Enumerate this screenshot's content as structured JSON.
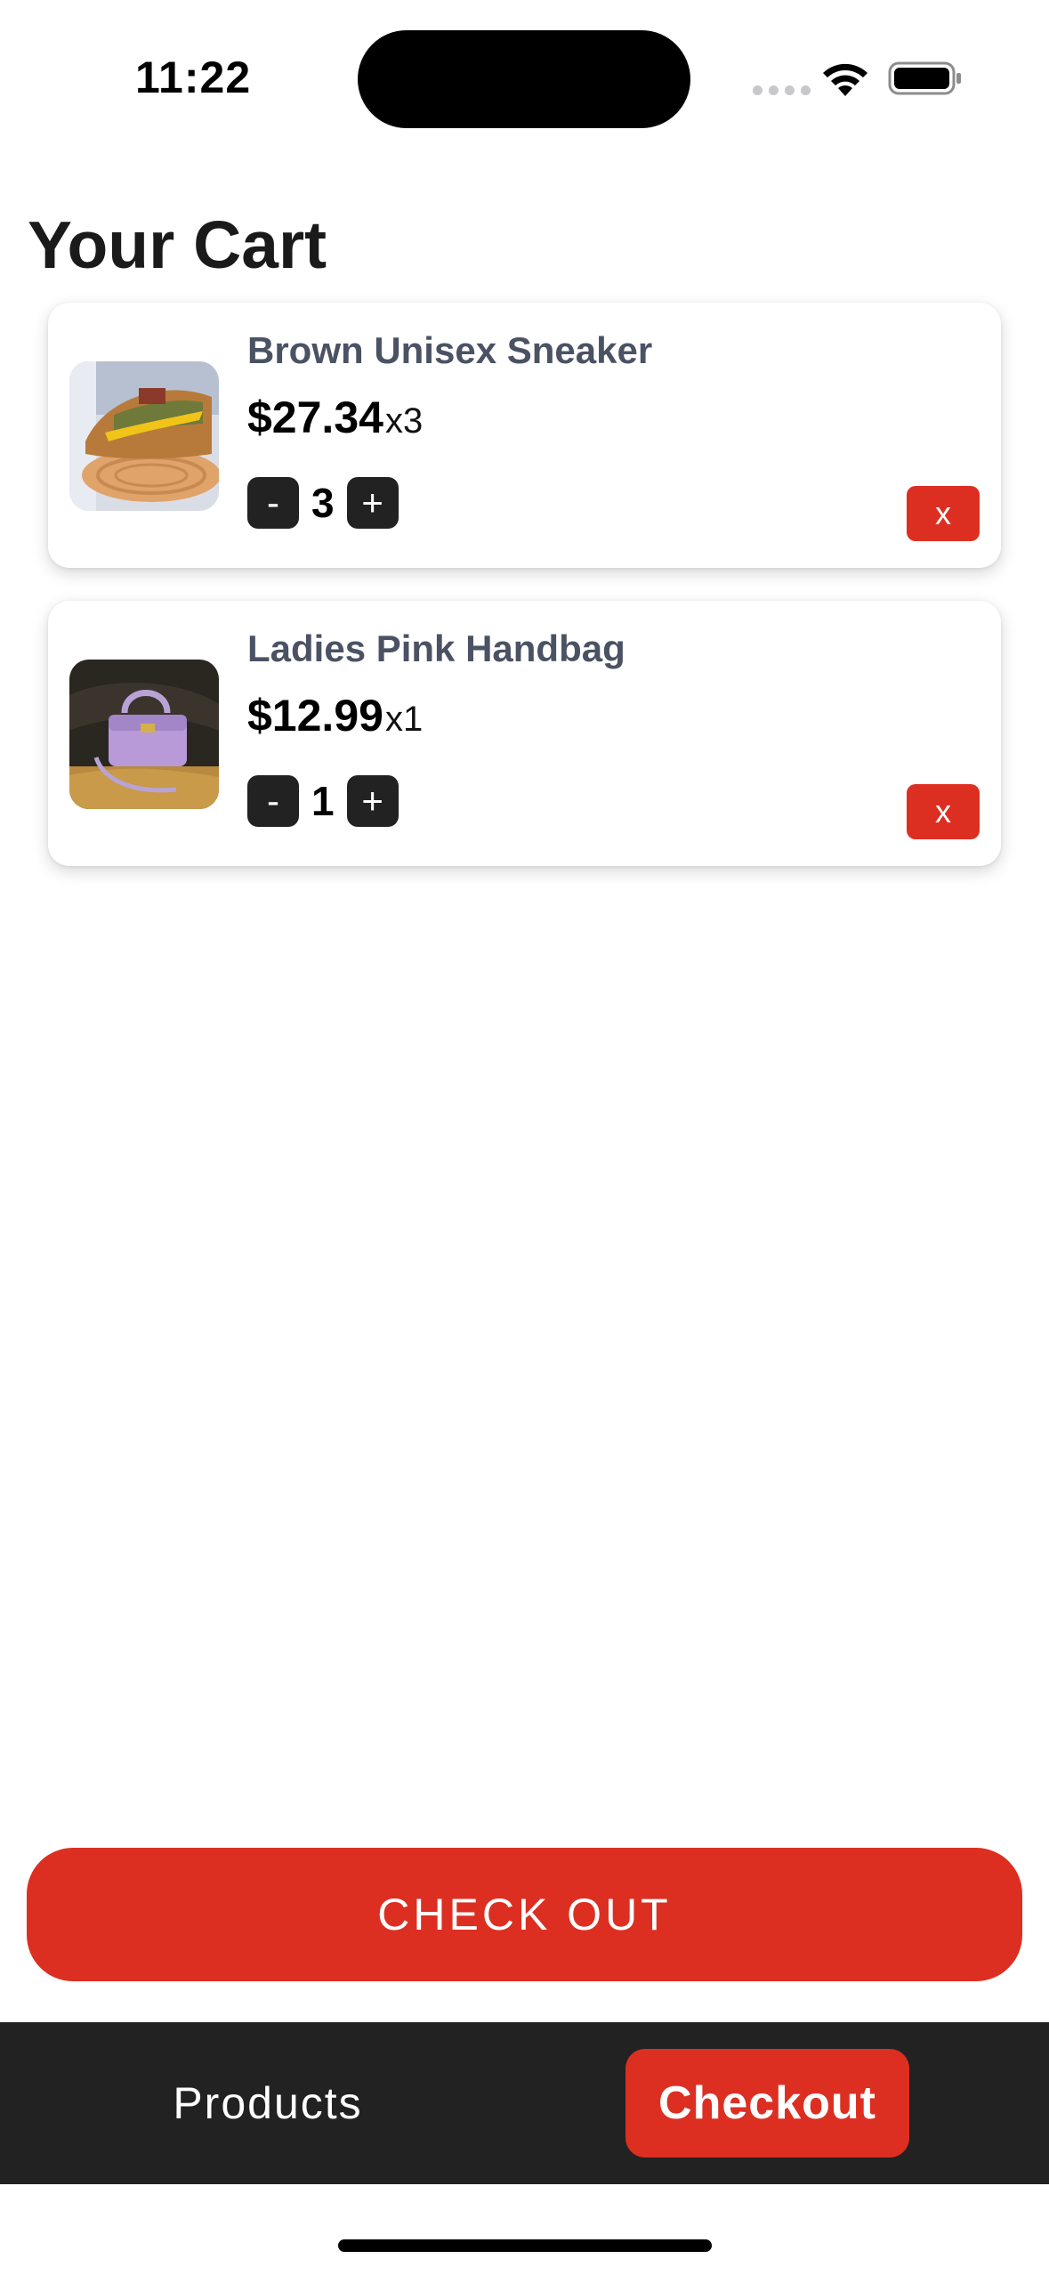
{
  "status_bar": {
    "time": "11:22"
  },
  "page": {
    "title": "Your Cart"
  },
  "cart": {
    "items": [
      {
        "name": "Brown Unisex Sneaker",
        "price": "$27.34",
        "multiplier": "x3",
        "quantity": "3",
        "decrement": "-",
        "increment": "+",
        "remove": "x",
        "image": "sneaker-photo"
      },
      {
        "name": "Ladies Pink Handbag",
        "price": "$12.99",
        "multiplier": "x1",
        "quantity": "1",
        "decrement": "-",
        "increment": "+",
        "remove": "x",
        "image": "handbag-photo"
      }
    ]
  },
  "checkout_button": {
    "label": "CHECK OUT"
  },
  "tab_bar": {
    "products": "Products",
    "checkout": "Checkout"
  },
  "colors": {
    "accent": "#dc2f22",
    "dark": "#222222",
    "item_name": "#4a5264"
  }
}
